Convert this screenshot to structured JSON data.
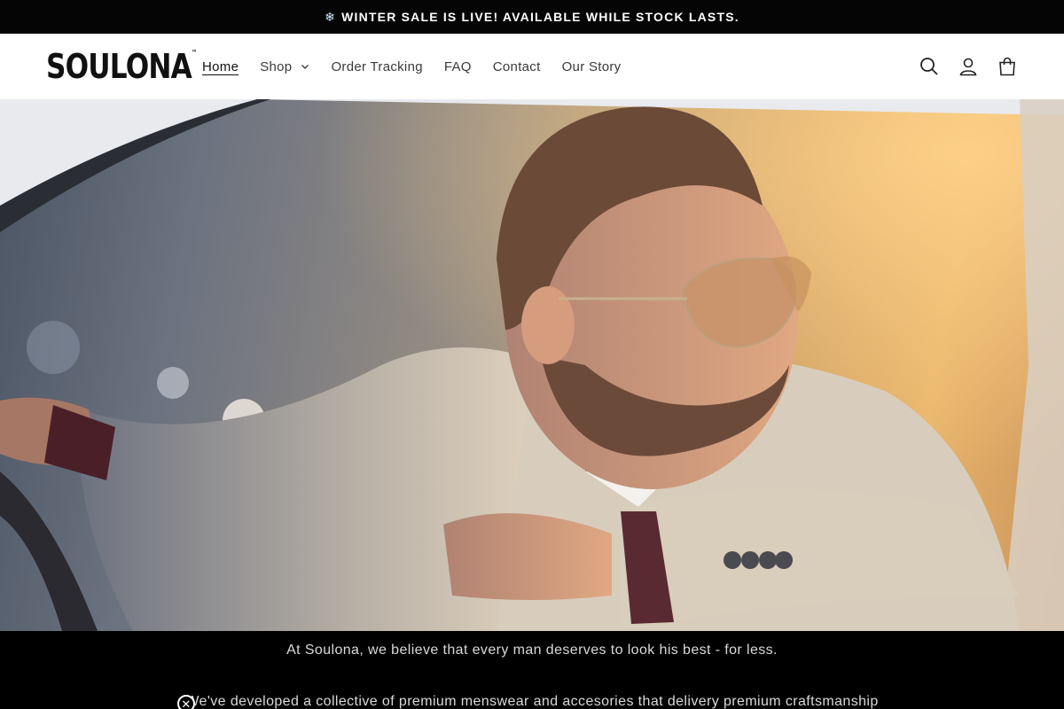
{
  "announcement": {
    "icon": "snowflake-icon",
    "text": "WINTER SALE IS LIVE! AVAILABLE WHILE STOCK LASTS."
  },
  "header": {
    "logo": "SOULONA",
    "nav": [
      {
        "label": "Home",
        "active": true
      },
      {
        "label": "Shop",
        "has_dropdown": true
      },
      {
        "label": "Order Tracking"
      },
      {
        "label": "FAQ"
      },
      {
        "label": "Contact"
      },
      {
        "label": "Our Story"
      }
    ],
    "icons": [
      "search-icon",
      "account-icon",
      "cart-icon"
    ]
  },
  "hero": {
    "image": "man-in-sunglasses-leaning-out-car-window"
  },
  "content": {
    "line1": "At Soulona, we believe that every man deserves to look his best - for less.",
    "line2": "We've developed a collective of premium menswear and accesories that delivery premium craftsmanship"
  },
  "colors": {
    "announcement_bg": "#050505",
    "header_bg": "#ffffff",
    "content_bg": "#000000",
    "text_light": "#d9d9d9"
  }
}
